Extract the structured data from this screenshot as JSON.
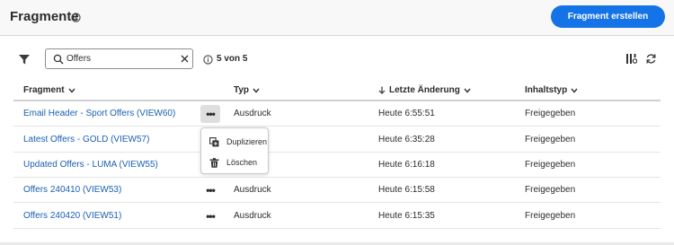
{
  "header": {
    "title": "Fragmente",
    "info_icon": "info-icon",
    "create_button_label": "Fragment erstellen",
    "accent_color": "#1473e6"
  },
  "toolbar": {
    "filter_icon": "filter-icon",
    "search": {
      "value": "Offers",
      "search_icon": "search-icon",
      "clear_icon": "close-icon"
    },
    "result_count": "5 von 5",
    "column_settings_icon": "column-settings-icon",
    "refresh_icon": "refresh-icon"
  },
  "table": {
    "columns": [
      {
        "label": "Fragment",
        "sort_icon": "chevron-down-icon"
      },
      {
        "label": "Typ",
        "sort_icon": "chevron-down-icon"
      },
      {
        "label": "Letzte Änderung",
        "sort_icon": "chevron-down-icon",
        "sorted": "descending"
      },
      {
        "label": "Inhaltstyp",
        "sort_icon": "chevron-down-icon"
      }
    ],
    "rows": [
      {
        "name": "Email Header - Sport Offers (VIEW60)",
        "typ": "Ausdruck",
        "date": "Heute 6:55:51",
        "status": "Freigegeben",
        "menu_open": true
      },
      {
        "name": "Latest Offers - GOLD (VIEW57)",
        "typ": "",
        "date": "Heute 6:35:28",
        "status": "Freigegeben"
      },
      {
        "name": "Updated Offers - LUMA (VIEW55)",
        "typ": "",
        "date": "Heute 6:16:18",
        "status": "Freigegeben"
      },
      {
        "name": "Offers 240410 (VIEW53)",
        "typ": "Ausdruck",
        "date": "Heute 6:15:58",
        "status": "Freigegeben"
      },
      {
        "name": "Offers 240420 (VIEW51)",
        "typ": "Ausdruck",
        "date": "Heute 6:15:35",
        "status": "Freigegeben"
      }
    ],
    "more_actions_glyph": "•••"
  },
  "context_menu": {
    "items": [
      {
        "label": "Duplizieren",
        "icon": "duplicate-icon"
      },
      {
        "label": "Löschen",
        "icon": "trash-icon"
      }
    ]
  }
}
